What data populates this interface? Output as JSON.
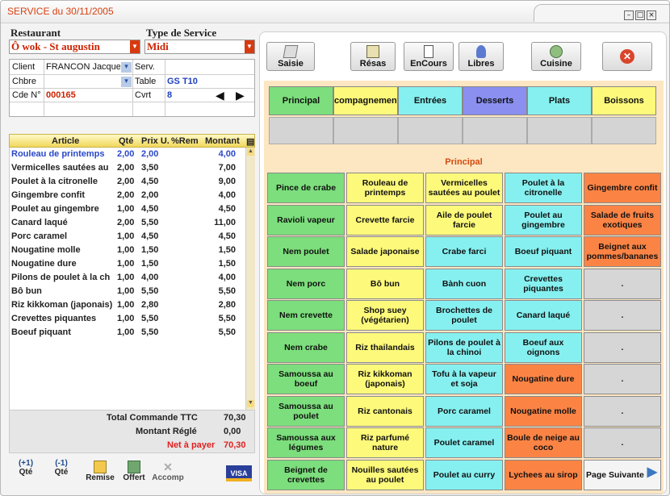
{
  "window": {
    "title": "SERVICE du 30/11/2005"
  },
  "header": {
    "restaurant_label": "Restaurant",
    "restaurant_value": "Ô wok - St augustin",
    "service_label": "Type de Service",
    "service_value": "Midi"
  },
  "info": {
    "client_label": "Client",
    "client_value": "FRANCON Jacques",
    "serv_label": "Serv.",
    "chbre_label": "Chbre",
    "table_label": "Table",
    "table_value": "GS T10",
    "cde_label": "Cde N°",
    "cde_value": "000165",
    "cvrt_label": "Cvrt",
    "cvrt_value": "8"
  },
  "grid": {
    "headers": [
      "Article",
      "Qté",
      "Prix U.",
      "%Rem",
      "Montant"
    ],
    "rows": [
      [
        "Rouleau de printemps",
        "2,00",
        "2,00",
        "",
        "4,00"
      ],
      [
        "Vermicelles sautées au",
        "2,00",
        "3,50",
        "",
        "7,00"
      ],
      [
        "Poulet à la citronelle",
        "2,00",
        "4,50",
        "",
        "9,00"
      ],
      [
        "Gingembre confit",
        "2,00",
        "2,00",
        "",
        "4,00"
      ],
      [
        "Poulet au gingembre",
        "1,00",
        "4,50",
        "",
        "4,50"
      ],
      [
        "Canard laqué",
        "2,00",
        "5,50",
        "",
        "11,00"
      ],
      [
        "Porc caramel",
        "1,00",
        "4,50",
        "",
        "4,50"
      ],
      [
        "Nougatine molle",
        "1,00",
        "1,50",
        "",
        "1,50"
      ],
      [
        "Nougatine dure",
        "1,00",
        "1,50",
        "",
        "1,50"
      ],
      [
        "Pilons de poulet à la ch",
        "1,00",
        "4,00",
        "",
        "4,00"
      ],
      [
        "Bô bun",
        "1,00",
        "5,50",
        "",
        "5,50"
      ],
      [
        "Riz kikkoman (japonais)",
        "1,00",
        "2,80",
        "",
        "2,80"
      ],
      [
        "Crevettes piquantes",
        "1,00",
        "5,50",
        "",
        "5,50"
      ],
      [
        "Boeuf piquant",
        "1,00",
        "5,50",
        "",
        "5,50"
      ]
    ]
  },
  "totals": {
    "ttc_label": "Total Commande TTC",
    "ttc_value": "70,30",
    "regle_label": "Montant Réglé",
    "regle_value": "0,00",
    "net_label": "Net à payer",
    "net_value": "70,30"
  },
  "bottom": {
    "plus_top": "(+1)",
    "plus": "Qté",
    "minus_top": "(-1)",
    "minus": "Qté",
    "remise": "Remise",
    "offert": "Offert",
    "accomp": "Accomp",
    "visa": "VISA"
  },
  "top": {
    "saisie": "Saisie",
    "resas": "Résas",
    "encours": "EnCours",
    "libres": "Libres",
    "cuisine": "Cuisine"
  },
  "categories": [
    "Principal",
    "Accompagnements",
    "Entrées",
    "Desserts",
    "Plats",
    "Boissons"
  ],
  "colors": {
    "accent": "#d94010",
    "cat_principal": "#7cde7c",
    "cat_accomp": "#fdf97a",
    "cat_entrees": "#86f0f0",
    "cat_desserts": "#8a8ff0",
    "cat_plats": "#86f0f0",
    "cat_boissons": "#fdf97a"
  },
  "current_category": "Principal",
  "items": [
    [
      "Pince de crabe",
      "Rouleau de printemps",
      "Vermicelles sautées au poulet",
      "Poulet à la citronelle",
      "Gingembre confit"
    ],
    [
      "Ravioli vapeur",
      "Crevette farcie",
      "Aile de poulet farcie",
      "Poulet au gingembre",
      "Salade de fruits exotiques"
    ],
    [
      "Nem poulet",
      "Salade japonaise",
      "Crabe farci",
      "Boeuf piquant",
      "Beignet aux pommes/bananes"
    ],
    [
      "Nem porc",
      "Bô bun",
      "Bành cuon",
      "Crevettes piquantes",
      "."
    ],
    [
      "Nem crevette",
      "Shop suey (végétarien)",
      "Brochettes de poulet",
      "Canard laqué",
      "."
    ],
    [
      "Nem crabe",
      "Riz thailandais",
      "Pilons de poulet à la chinoi",
      "Boeuf aux oignons",
      "."
    ],
    [
      "Samoussa au boeuf",
      "Riz kikkoman (japonais)",
      "Tofu à la vapeur et soja",
      "Nougatine dure",
      "."
    ],
    [
      "Samoussa au poulet",
      "Riz cantonais",
      "Porc caramel",
      "Nougatine molle",
      "."
    ],
    [
      "Samoussa aux légumes",
      "Riz parfumé nature",
      "Poulet caramel",
      "Boule de neige au coco",
      "."
    ],
    [
      "Beignet de crevettes",
      "Nouilles sautées au poulet",
      "Poulet au curry",
      "Lychees au sirop",
      "Page Suivante"
    ]
  ]
}
